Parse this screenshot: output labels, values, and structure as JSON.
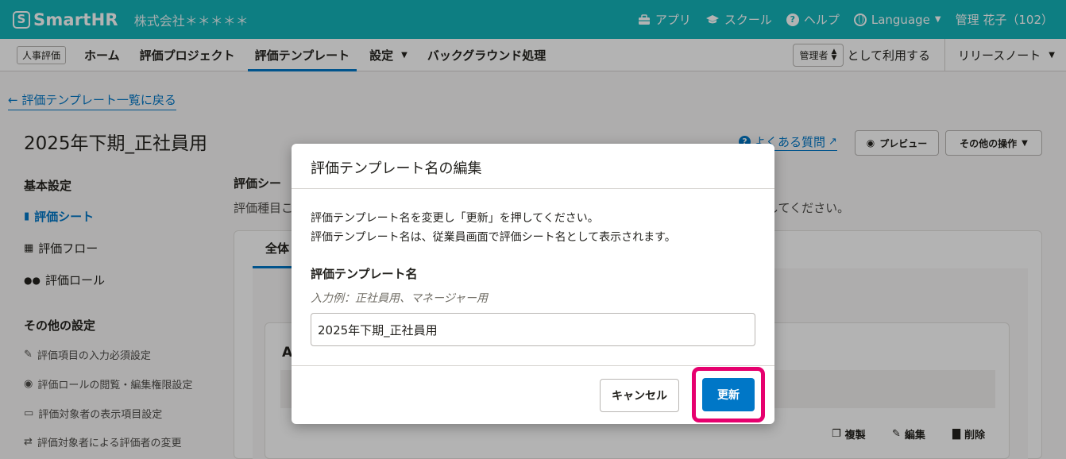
{
  "header": {
    "logo_mark": "S",
    "logo_text": "SmartHR",
    "company": "株式会社＊＊＊＊＊",
    "apps": "アプリ",
    "school": "スクール",
    "help": "ヘルプ",
    "language": "Language",
    "user": "管理 花子（102）"
  },
  "nav": {
    "app_badge": "人事評価",
    "tabs": [
      {
        "label": "ホーム"
      },
      {
        "label": "評価プロジェクト"
      },
      {
        "label": "評価テンプレート"
      },
      {
        "label": "設定"
      },
      {
        "label": "バックグラウンド処理"
      }
    ],
    "role_select": "管理者",
    "role_suffix": "として利用する",
    "release_notes": "リリースノート"
  },
  "page": {
    "back_link": "評価テンプレート一覧に戻る",
    "title": "2025年下期_正社員用",
    "faq": "よくある質問",
    "preview": "プレビュー",
    "other_actions": "その他の操作"
  },
  "sidebar": {
    "basic_heading": "基本設定",
    "basic_items": [
      {
        "label": "評価シート"
      },
      {
        "label": "評価フロー"
      },
      {
        "label": "評価ロール"
      }
    ],
    "other_heading": "その他の設定",
    "other_items": [
      {
        "label": "評価項目の入力必須設定"
      },
      {
        "label": "評価ロールの閲覧・編集権限設定"
      },
      {
        "label": "評価対象者の表示項目設定"
      },
      {
        "label": "評価対象者による評価者の変更"
      }
    ]
  },
  "main": {
    "section_heading": "評価シー",
    "section_desc_left": "評価種目こ",
    "section_desc_right": "してください。",
    "tab_all": "全体",
    "inner_letter": "A",
    "actions": {
      "copy": "複製",
      "edit": "編集",
      "delete": "削除"
    }
  },
  "dialog": {
    "title": "評価テンプレート名の編集",
    "desc_line1": "評価テンプレート名を変更し「更新」を押してください。",
    "desc_line2": "評価テンプレート名は、従業員画面で評価シート名として表示されます。",
    "field_label": "評価テンプレート名",
    "field_hint": "入力例：正社員用、マネージャー用",
    "field_value": "2025年下期_正社員用",
    "cancel": "キャンセル",
    "update": "更新"
  },
  "colors": {
    "header_bg": "#12b3b9",
    "accent": "#0077c7",
    "highlight": "#e6006e"
  }
}
